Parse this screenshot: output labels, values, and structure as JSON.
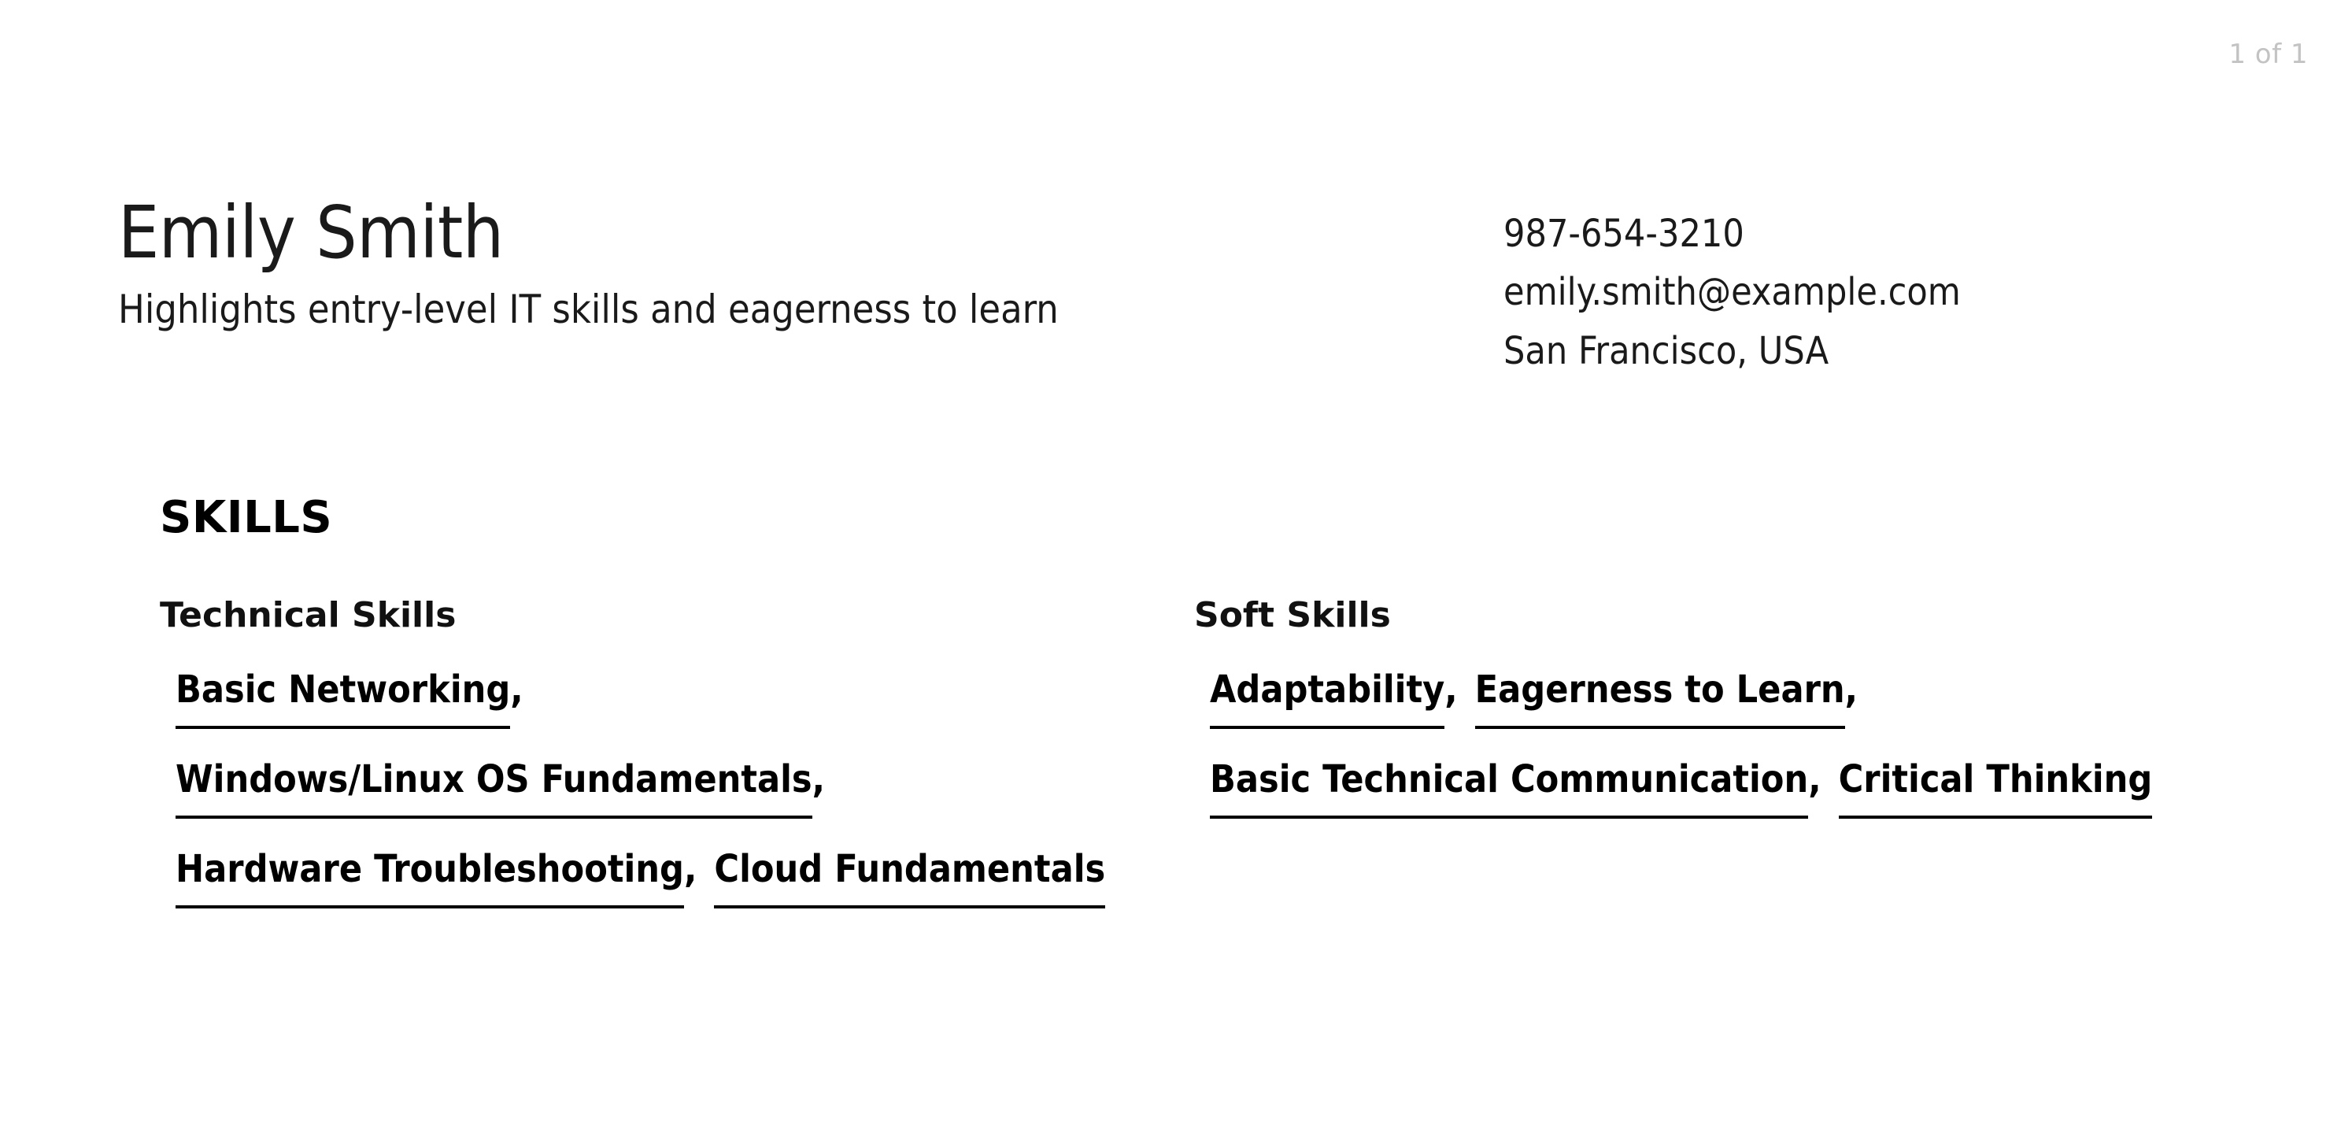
{
  "document": {
    "page_indicator": "1 of 1",
    "type": "resume"
  },
  "header": {
    "name": "Emily Smith",
    "tagline": "Highlights entry-level IT skills and eagerness to learn",
    "contact": {
      "phone": "987-654-3210",
      "email": "emily.smith@example.com",
      "location": "San Francisco, USA"
    }
  },
  "skills_section": {
    "title": "SKILLS",
    "columns": [
      {
        "heading": "Technical Skills",
        "items": [
          {
            "label": "Basic Networking",
            "separator": ","
          },
          {
            "label": "Windows/Linux OS Fundamentals",
            "separator": ","
          },
          {
            "label": "Hardware Troubleshooting",
            "separator": ","
          },
          {
            "label": "Cloud Fundamentals",
            "separator": ""
          }
        ]
      },
      {
        "heading": "Soft Skills",
        "items": [
          {
            "label": "Adaptability",
            "separator": ","
          },
          {
            "label": "Eagerness to Learn",
            "separator": ","
          },
          {
            "label": "Basic Technical Communication",
            "separator": ","
          },
          {
            "label": "Critical Thinking",
            "separator": ""
          }
        ]
      }
    ]
  },
  "colors": {
    "background": "#ffffff",
    "text": "#111111",
    "page_indicator": "#c3c3c3",
    "underline": "#000000"
  }
}
